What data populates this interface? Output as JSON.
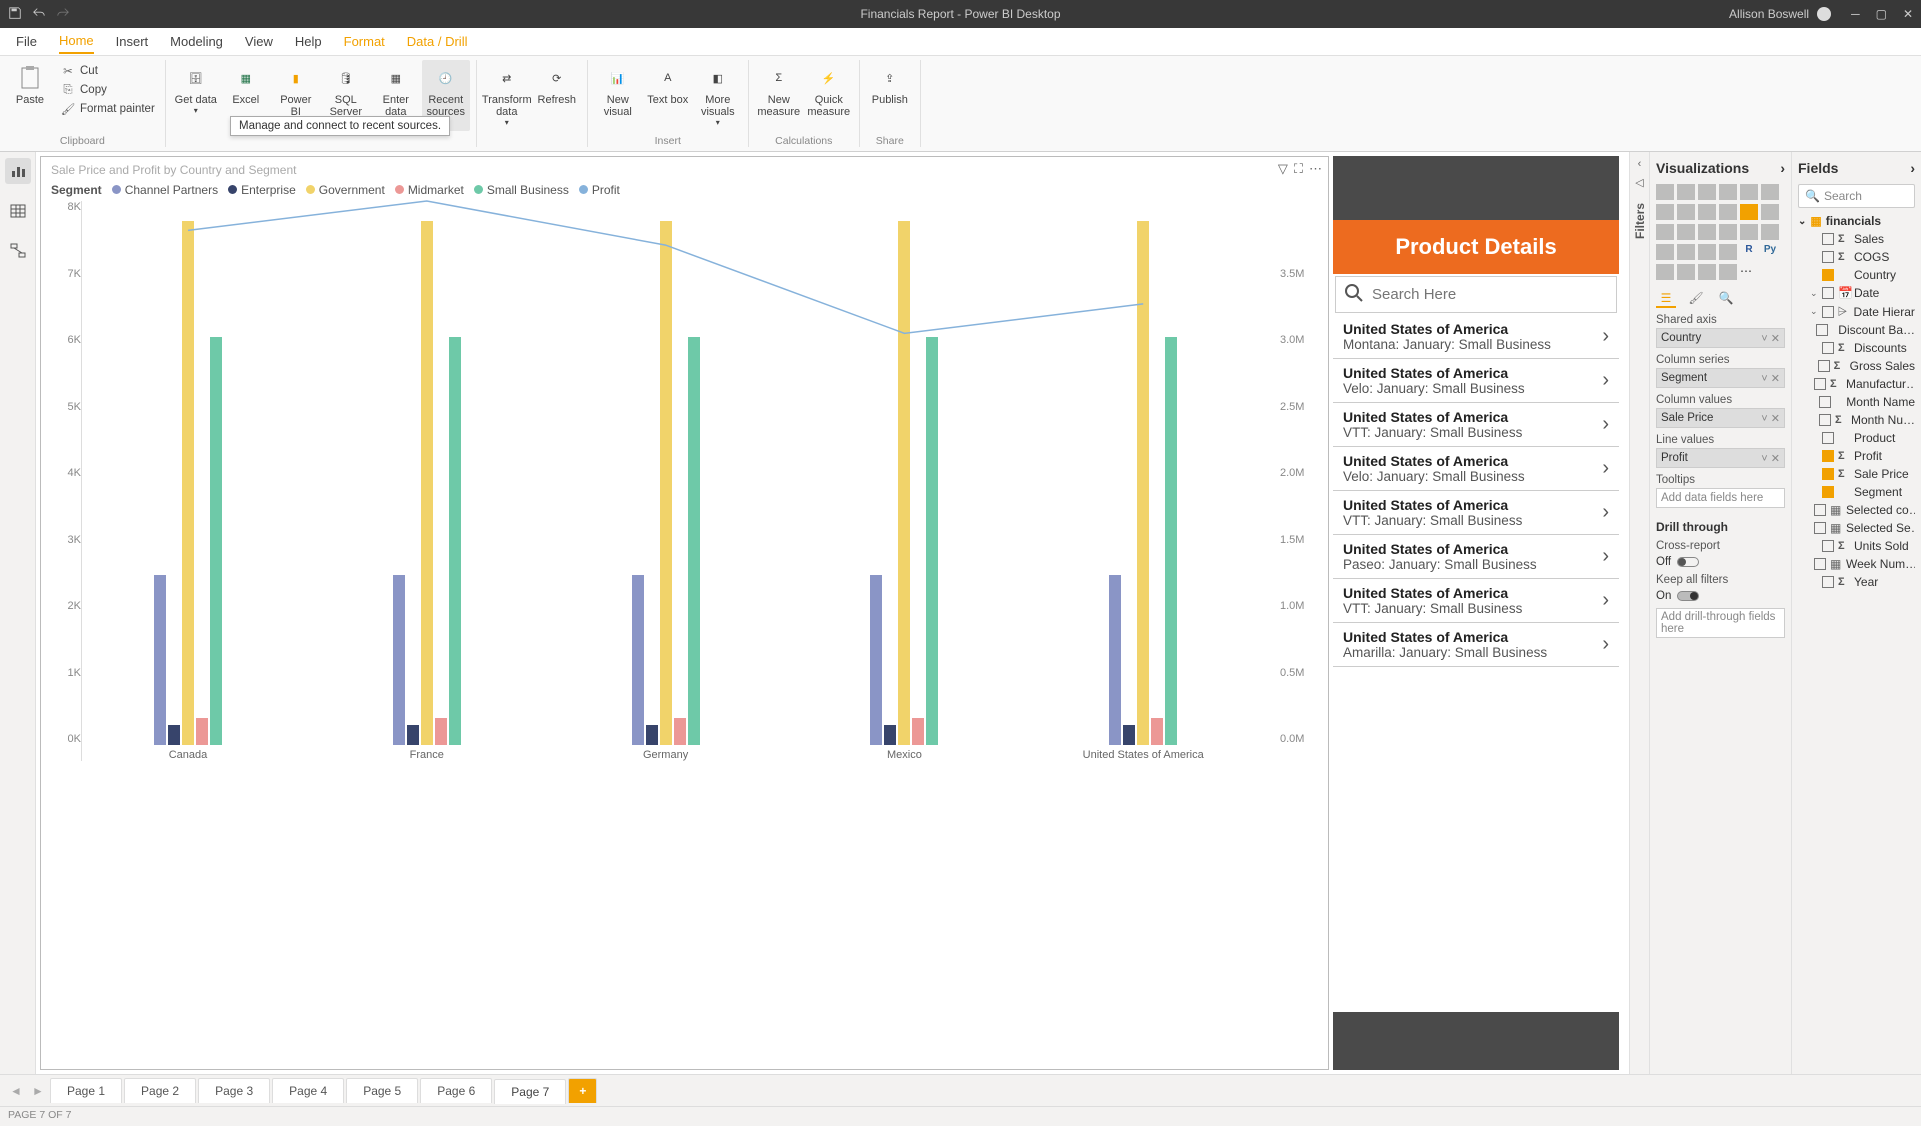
{
  "app": {
    "title": "Financials Report - Power BI Desktop",
    "user": "Allison Boswell"
  },
  "ribbon": {
    "tabs": [
      "File",
      "Home",
      "Insert",
      "Modeling",
      "View",
      "Help",
      "Format",
      "Data / Drill"
    ],
    "active_tab": "Home",
    "clipboard": {
      "label": "Clipboard",
      "paste": "Paste",
      "cut": "Cut",
      "copy": "Copy",
      "format_painter": "Format painter"
    },
    "data": {
      "get_data": "Get data",
      "excel": "Excel",
      "pbi_ds": "Power BI datasets",
      "sql": "SQL Server",
      "enter": "Enter data",
      "recent": "Recent sources"
    },
    "queries": {
      "transform": "Transform data",
      "refresh": "Refresh"
    },
    "insert": {
      "label": "Insert",
      "visual": "New visual",
      "textbox": "Text box",
      "more": "More visuals"
    },
    "calc": {
      "label": "Calculations",
      "measure": "New measure",
      "quick": "Quick measure"
    },
    "share": {
      "label": "Share",
      "publish": "Publish"
    },
    "tooltip": "Manage and connect to recent sources."
  },
  "chart": {
    "title": "Sale Price and Profit by Country and Segment",
    "legend_label": "Segment",
    "legend": [
      {
        "name": "Channel Partners",
        "color": "#8a95c6"
      },
      {
        "name": "Enterprise",
        "color": "#37446b"
      },
      {
        "name": "Government",
        "color": "#f1d36a"
      },
      {
        "name": "Midmarket",
        "color": "#ec9896"
      },
      {
        "name": "Small Business",
        "color": "#6ec9a8"
      },
      {
        "name": "Profit",
        "color": "#86b2db"
      }
    ]
  },
  "chart_data": {
    "type": "bar+line",
    "categories": [
      "Canada",
      "France",
      "Germany",
      "Mexico",
      "United States of America"
    ],
    "y_left": {
      "ticks": [
        "8K",
        "7K",
        "6K",
        "5K",
        "4K",
        "3K",
        "2K",
        "1K",
        "0K"
      ],
      "max": 8000
    },
    "y_right": {
      "ticks": [
        "3.5M",
        "3.0M",
        "2.5M",
        "2.0M",
        "1.5M",
        "1.0M",
        "0.5M",
        "0.0M"
      ],
      "max": 3700000
    },
    "series": [
      {
        "name": "Channel Partners",
        "color": "#8a95c6",
        "values": [
          2500,
          2500,
          2500,
          2500,
          2500
        ]
      },
      {
        "name": "Enterprise",
        "color": "#37446b",
        "values": [
          300,
          300,
          300,
          300,
          300
        ]
      },
      {
        "name": "Government",
        "color": "#f1d36a",
        "values": [
          7700,
          7700,
          7700,
          7700,
          7700
        ]
      },
      {
        "name": "Midmarket",
        "color": "#ec9896",
        "values": [
          400,
          400,
          400,
          400,
          400
        ]
      },
      {
        "name": "Small Business",
        "color": "#6ec9a8",
        "values": [
          6000,
          6000,
          6000,
          6000,
          6000
        ]
      }
    ],
    "line": {
      "name": "Profit",
      "color": "#86b2db",
      "values": [
        3500000,
        3700000,
        3400000,
        2800000,
        3000000
      ]
    }
  },
  "details": {
    "title": "Product Details",
    "search_placeholder": "Search Here",
    "items": [
      {
        "t1": "United States of America",
        "t2": "Montana: January: Small Business"
      },
      {
        "t1": "United States of America",
        "t2": "Velo: January: Small Business"
      },
      {
        "t1": "United States of America",
        "t2": "VTT: January: Small Business"
      },
      {
        "t1": "United States of America",
        "t2": "Velo: January: Small Business"
      },
      {
        "t1": "United States of America",
        "t2": "VTT: January: Small Business"
      },
      {
        "t1": "United States of America",
        "t2": "Paseo: January: Small Business"
      },
      {
        "t1": "United States of America",
        "t2": "VTT: January: Small Business"
      },
      {
        "t1": "United States of America",
        "t2": "Amarilla: January: Small Business"
      }
    ]
  },
  "viz_pane": {
    "title": "Visualizations",
    "wells": {
      "shared_axis": {
        "label": "Shared axis",
        "value": "Country"
      },
      "column_series": {
        "label": "Column series",
        "value": "Segment"
      },
      "column_values": {
        "label": "Column values",
        "value": "Sale Price"
      },
      "line_values": {
        "label": "Line values",
        "value": "Profit"
      },
      "tooltips": {
        "label": "Tooltips",
        "placeholder": "Add data fields here"
      }
    },
    "drill_through": "Drill through",
    "cross_report": {
      "label": "Cross-report",
      "state": "Off"
    },
    "keep_filters": {
      "label": "Keep all filters",
      "state": "On"
    },
    "drill_placeholder": "Add drill-through fields here"
  },
  "filters_label": "Filters",
  "fields_pane": {
    "title": "Fields",
    "search_placeholder": "Search",
    "table": "financials",
    "fields": [
      {
        "name": "Sales",
        "checked": false,
        "sigma": true
      },
      {
        "name": "COGS",
        "checked": false,
        "sigma": true
      },
      {
        "name": "Country",
        "checked": true,
        "sigma": false
      },
      {
        "name": "Date",
        "checked": false,
        "sigma": false,
        "cal": true,
        "expandable": true
      },
      {
        "name": "Date Hierar…",
        "checked": false,
        "sigma": false,
        "hier": true,
        "expandable": true
      },
      {
        "name": "Discount Ba…",
        "checked": false,
        "sigma": false
      },
      {
        "name": "Discounts",
        "checked": false,
        "sigma": true
      },
      {
        "name": "Gross Sales",
        "checked": false,
        "sigma": true
      },
      {
        "name": "Manufactur…",
        "checked": false,
        "sigma": true
      },
      {
        "name": "Month Name",
        "checked": false,
        "sigma": false
      },
      {
        "name": "Month Nu…",
        "checked": false,
        "sigma": true
      },
      {
        "name": "Product",
        "checked": false,
        "sigma": false
      },
      {
        "name": "Profit",
        "checked": true,
        "sigma": true
      },
      {
        "name": "Sale Price",
        "checked": true,
        "sigma": true
      },
      {
        "name": "Segment",
        "checked": true,
        "sigma": false
      },
      {
        "name": "Selected co…",
        "checked": false,
        "sigma": false,
        "tbl": true
      },
      {
        "name": "Selected Se…",
        "checked": false,
        "sigma": false,
        "tbl": true
      },
      {
        "name": "Units Sold",
        "checked": false,
        "sigma": true
      },
      {
        "name": "Week Num…",
        "checked": false,
        "sigma": false,
        "tbl": true
      },
      {
        "name": "Year",
        "checked": false,
        "sigma": true
      }
    ]
  },
  "pages": {
    "list": [
      "Page 1",
      "Page 2",
      "Page 3",
      "Page 4",
      "Page 5",
      "Page 6",
      "Page 7"
    ],
    "active": "Page 7"
  },
  "status": "PAGE 7 OF 7"
}
